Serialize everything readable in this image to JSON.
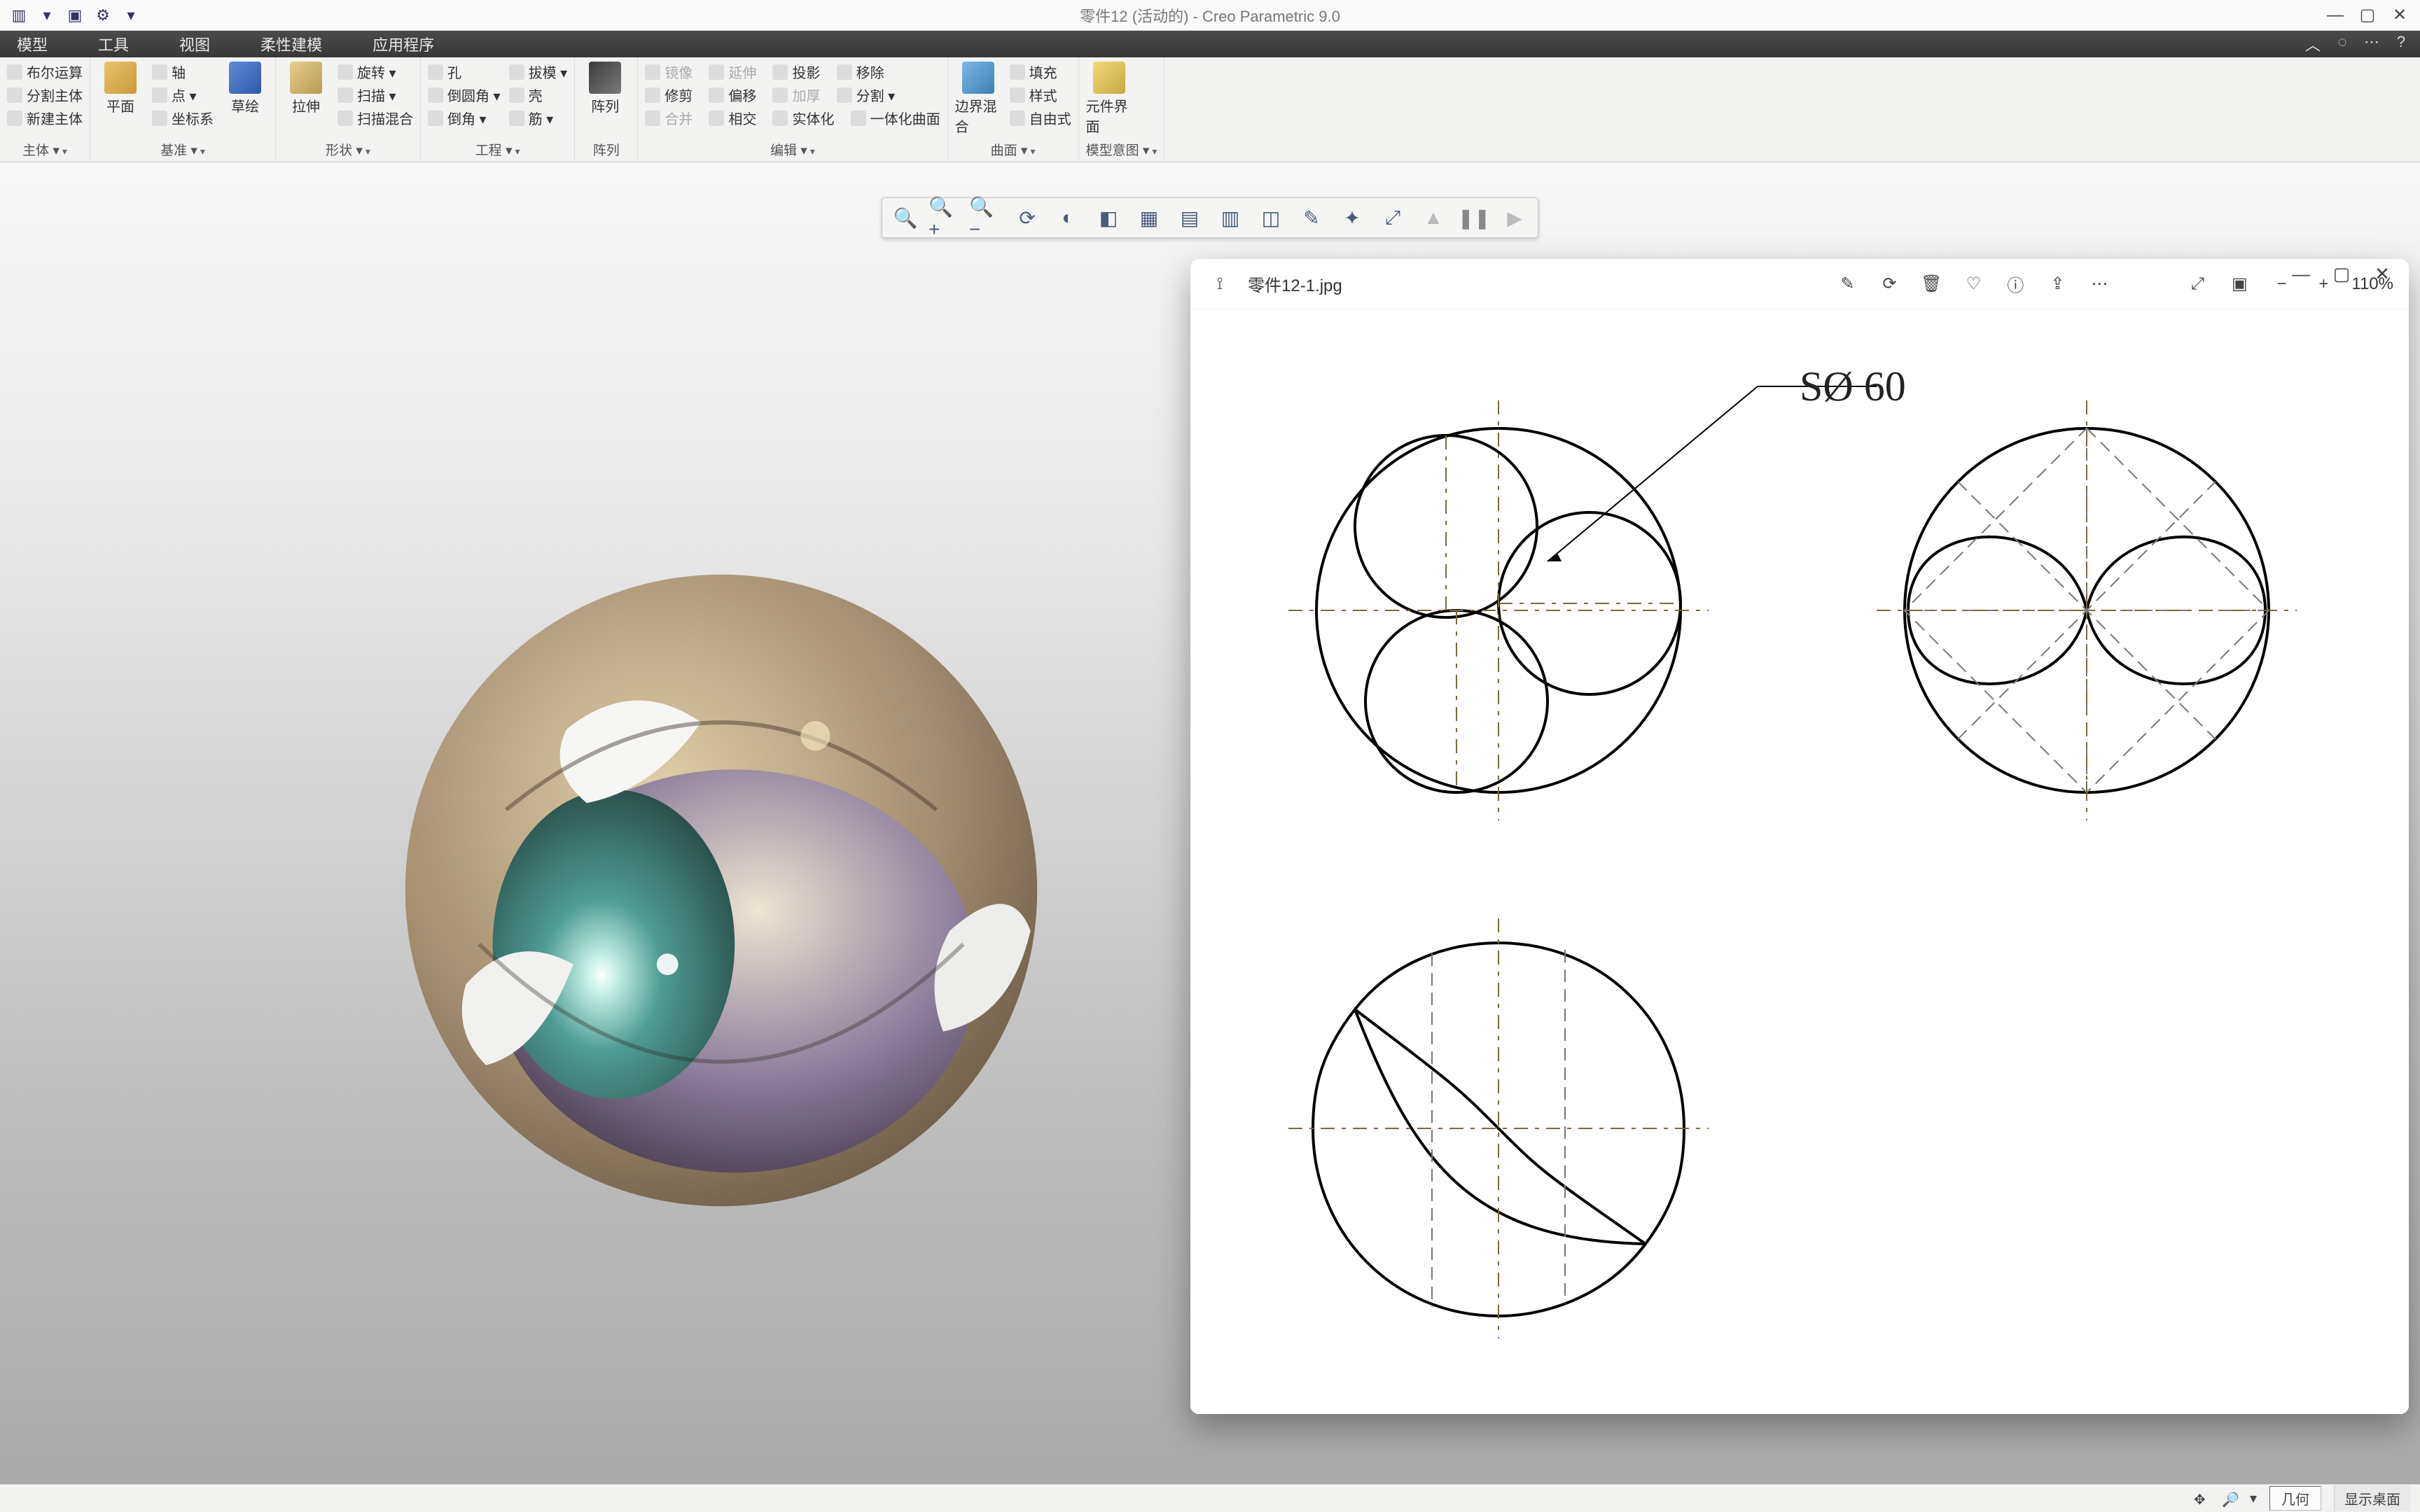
{
  "titlebar": {
    "title": "零件12 (活动的) - Creo Parametric 9.0"
  },
  "menubar": {
    "items": [
      "模型",
      "工具",
      "视图",
      "柔性建模",
      "应用程序"
    ]
  },
  "ribbon": {
    "groups": [
      {
        "label": "主体 ▾",
        "items": [
          "布尔运算",
          "分割主体",
          "新建主体"
        ]
      },
      {
        "label": "基准 ▾",
        "big": "平面",
        "items": [
          "轴",
          "点 ▾",
          "坐标系"
        ],
        "extra": "草绘"
      },
      {
        "label": "形状 ▾",
        "big": "拉伸",
        "items": [
          "旋转 ▾",
          "扫描 ▾",
          "扫描混合"
        ]
      },
      {
        "label": "工程 ▾",
        "items_col1": [
          "孔",
          "倒圆角 ▾",
          "倒角 ▾"
        ],
        "items_col2": [
          "拔模 ▾",
          "壳",
          "筋 ▾"
        ]
      },
      {
        "label": "阵列"
      },
      {
        "label": "编辑 ▾",
        "row1": [
          "镜像",
          "延伸",
          "投影",
          "移除"
        ],
        "row2": [
          "修剪",
          "偏移",
          "加厚",
          "分割 ▾"
        ],
        "row3": [
          "合并",
          "相交",
          "实体化",
          "一体化曲面"
        ]
      },
      {
        "label": "曲面 ▾",
        "big": "边界混合",
        "items": [
          "填充",
          "样式",
          "自由式"
        ]
      },
      {
        "label": "模型意图 ▾",
        "big": "元件界面"
      }
    ]
  },
  "in_graphics_toolbar": {
    "buttons": [
      "zoom-fit",
      "zoom-in",
      "zoom-out",
      "repaint",
      "shaded",
      "shaded-edges",
      "wireframe",
      "no-hidden",
      "hidden",
      "perspective",
      "annotation",
      "datum-display",
      "saved-view",
      "pause",
      "play"
    ]
  },
  "statusbar": {
    "selection_filter": "几何",
    "show_desktop": "显示桌面"
  },
  "viewer": {
    "filename": "零件12-1.jpg",
    "zoom": "110%",
    "dimension_label": "SØ 60"
  }
}
